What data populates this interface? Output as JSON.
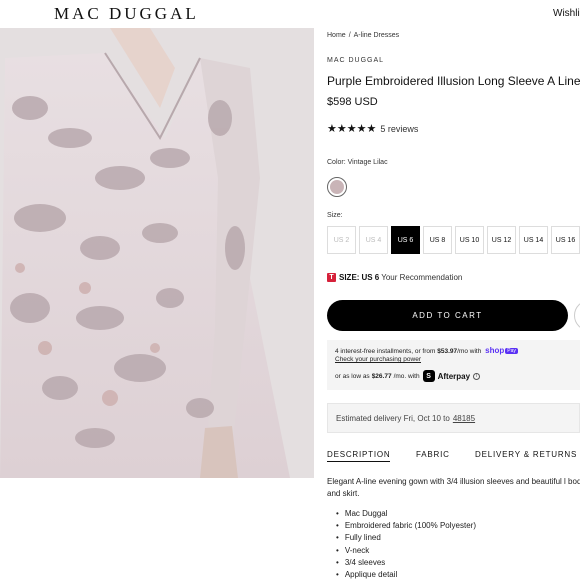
{
  "header": {
    "logo": "MAC DUGGAL",
    "wishlist": "Wishlis"
  },
  "breadcrumb": {
    "home": "Home",
    "separator": "/",
    "category": "A-line Dresses"
  },
  "product": {
    "brand": "MAC DUGGAL",
    "title": "Purple Embroidered Illusion Long Sleeve A Line Gov",
    "price": "$598 USD",
    "stars": "★★★★★",
    "rating": 5,
    "reviews": "5 reviews",
    "color_label": "Color: Vintage Lilac",
    "swatch_color": "#c9b4b7",
    "size_label": "Size:",
    "sizes": [
      "US 2",
      "US 4",
      "US 6",
      "US 8",
      "US 10",
      "US 12",
      "US 14",
      "US 16"
    ],
    "selected_size": "US 6",
    "fit_badge": "T",
    "fit_size_label": "SIZE:",
    "fit_size_value": "US 6",
    "fit_note": "Your Recommendation",
    "add_to_cart": "ADD TO CART"
  },
  "payments": {
    "shop_pay_line_start": "4 interest-free installments, or from",
    "shop_pay_amount": "$53.97",
    "shop_pay_line_mid": "/mo with",
    "shop_pay_brand": "shop",
    "shop_pay_chip": "Pay",
    "shop_pay_link": "Check your purchasing power",
    "afterpay_start": "or as low as",
    "afterpay_amount": "$26.77",
    "afterpay_mid": "/mo. with",
    "afterpay_icon": "S",
    "afterpay_brand": "Afterpay",
    "info_icon": "i"
  },
  "delivery": {
    "text": "Estimated delivery Fri, Oct 10 to",
    "zip": "48185"
  },
  "tabs": [
    "DESCRIPTION",
    "FABRIC",
    "DELIVERY & RETURNS"
  ],
  "description": {
    "text": "Elegant A-line evening gown with 3/4 illusion sleeves and beautiful l bodice and skirt.",
    "bullets": [
      "Mac Duggal",
      "Embroidered fabric (100% Polyester)",
      "Fully lined",
      "V-neck",
      "3/4 sleeves",
      "Applique detail"
    ]
  },
  "colors": {
    "accent": "#000000",
    "shop_pay": "#5a31f4",
    "fit_badge": "#d6213a",
    "panel_bg": "#f4f4f4"
  }
}
